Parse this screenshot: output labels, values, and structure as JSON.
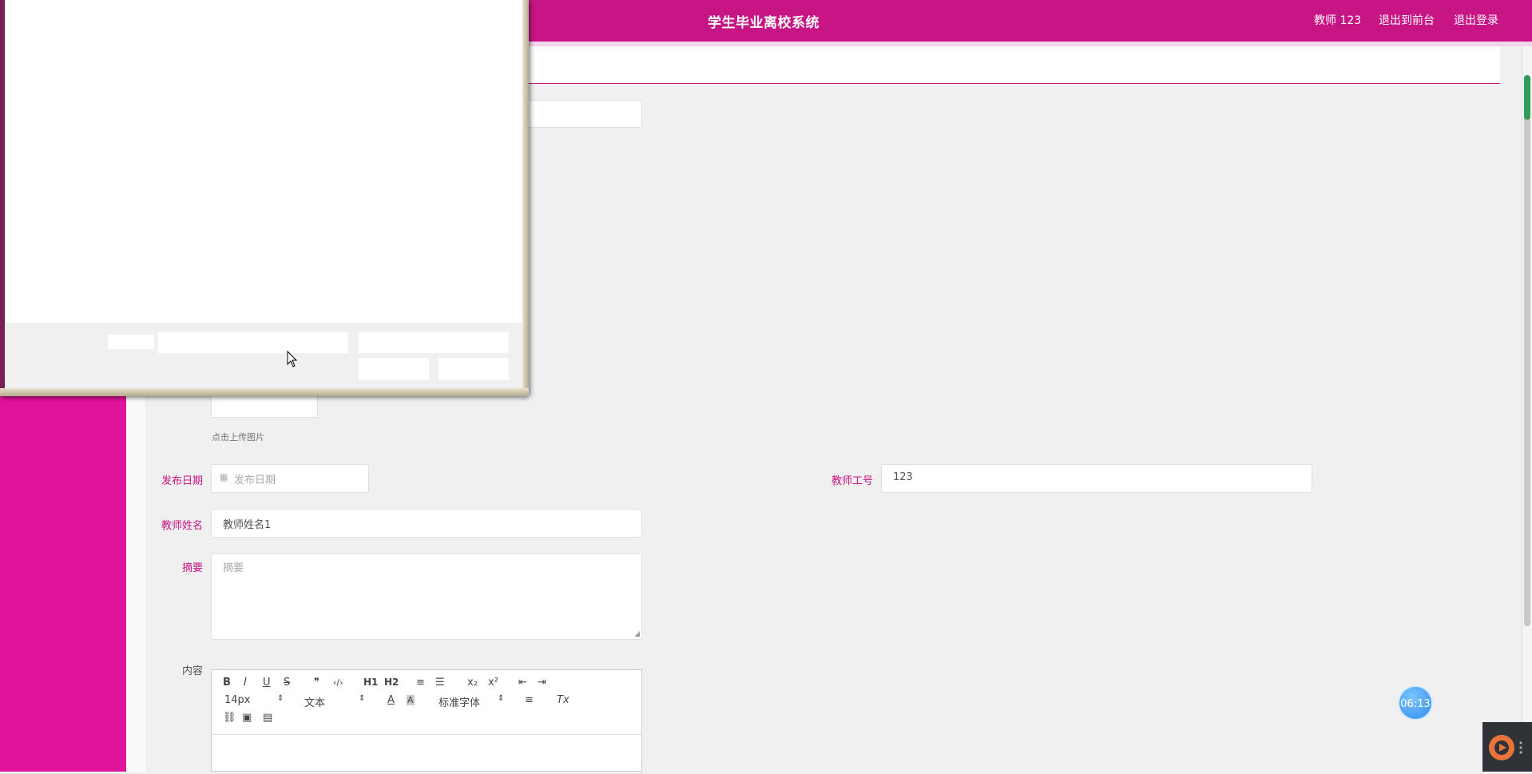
{
  "header": {
    "title": "学生毕业离校系统",
    "user": "教师 123",
    "back_to_front": "退出到前台",
    "logout": "退出登录"
  },
  "form": {
    "upload_hint": "点击上传图片",
    "publish_date_label": "发布日期",
    "publish_date_placeholder": "发布日期",
    "teacher_id_label": "教师工号",
    "teacher_id_value": "123",
    "teacher_name_label": "教师姓名",
    "teacher_name_value": "教师姓名1",
    "summary_label": "摘要",
    "summary_placeholder": "摘要",
    "content_label": "内容"
  },
  "editor": {
    "font_size": "14px",
    "paragraph": "文本",
    "font_family": "标准字体",
    "bold": "B",
    "italic": "I",
    "underline": "U",
    "strike": "S",
    "quote": "❞",
    "code": "‹/›",
    "h1": "H1",
    "h2": "H2",
    "ordered": "≡",
    "bullet": "☰",
    "sub": "x₂",
    "sup": "x²",
    "outdent": "⇤",
    "indent": "⇥",
    "color": "A",
    "bg_color": "A",
    "align": "≡",
    "clear": "Tx",
    "link": "⛓",
    "image": "▣",
    "video": "▤"
  },
  "timer": "06:13",
  "colors": {
    "brand": "#c71585",
    "sidebar": "#e0139a"
  }
}
